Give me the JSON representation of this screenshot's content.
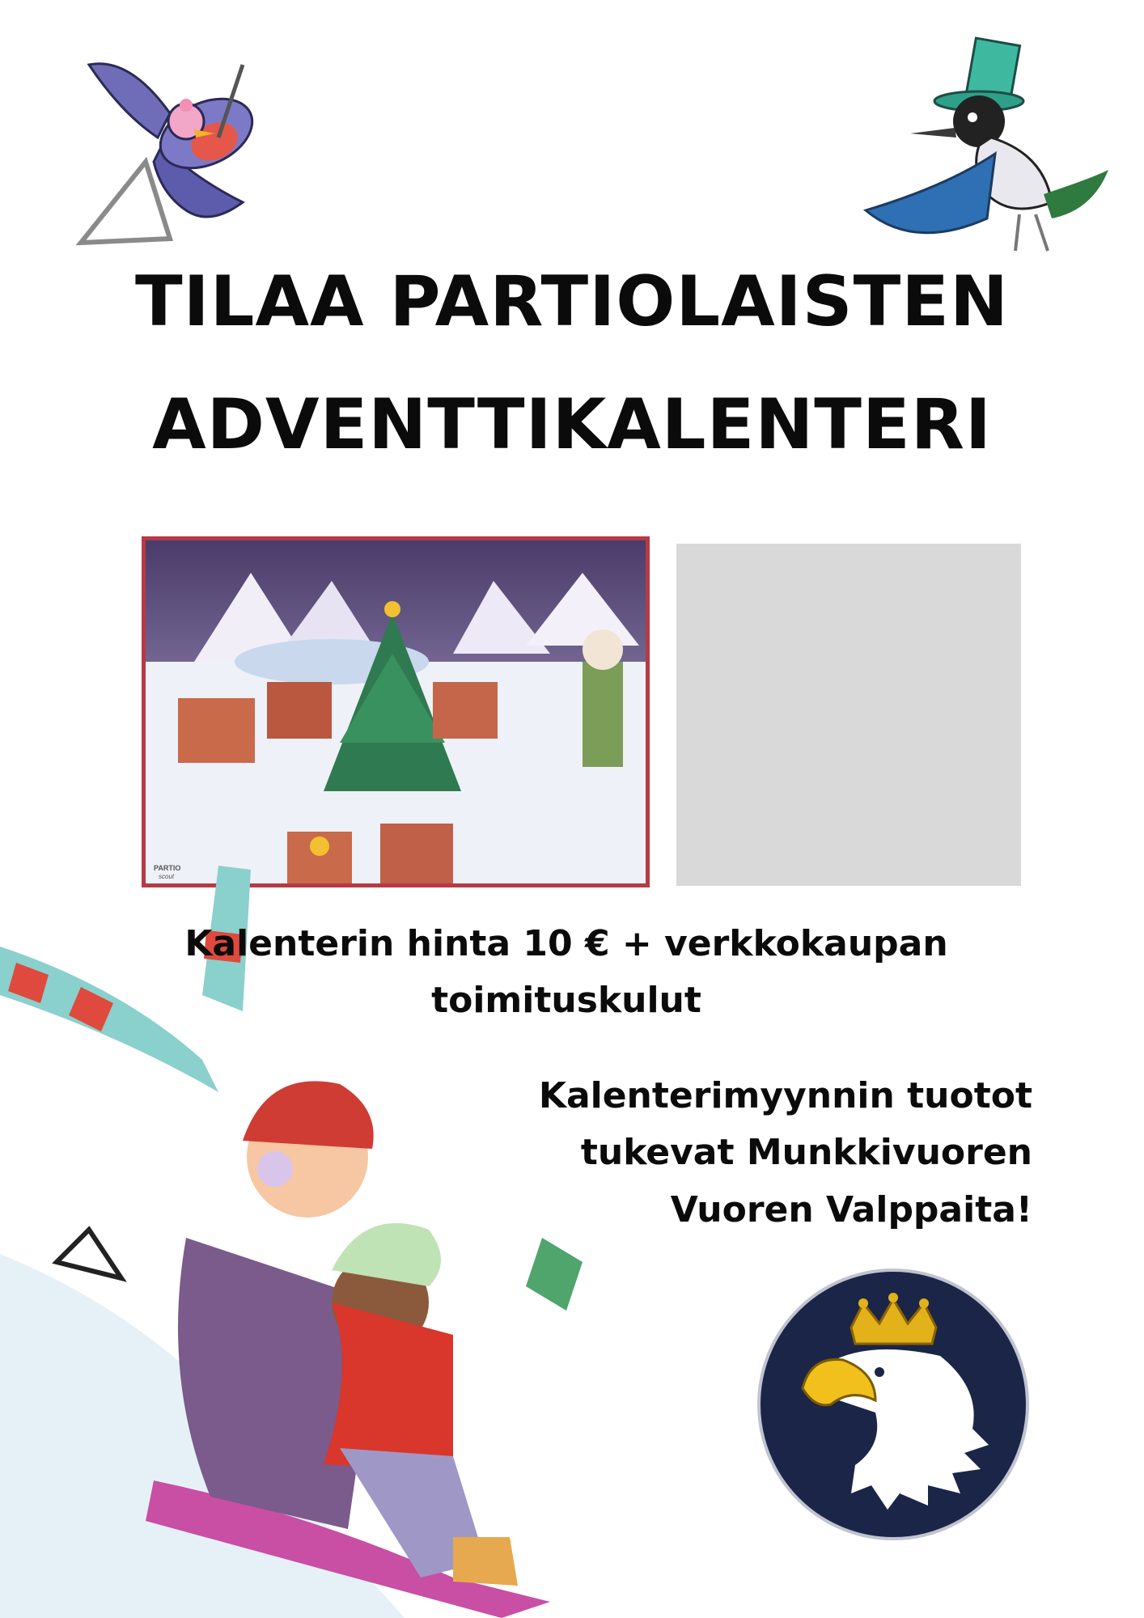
{
  "title": {
    "line1": "TILAA PARTIOLAISTEN",
    "line2": "ADVENTTIKALENTERI"
  },
  "price": {
    "line1": "Kalenterin hinta 10 € + verkkokaupan",
    "line2": "toimituskulut"
  },
  "proceeds": {
    "line1": "Kalenterimyynnin tuotot",
    "line2": "tukevat Munkkivuoren",
    "line3": "Vuoren Valppaita!"
  },
  "calendar": {
    "brand_line1": "PARTIO",
    "brand_line2": "scout"
  },
  "colors": {
    "frame": "#b53a46",
    "placeholder": "#d9d9d9",
    "logo_bg": "#1b2548",
    "crown": "#e3b21a"
  },
  "icons": [
    "bird-triangle-icon",
    "magpie-hat-icon",
    "sledding-kids-illustration",
    "eagle-crown-logo"
  ]
}
